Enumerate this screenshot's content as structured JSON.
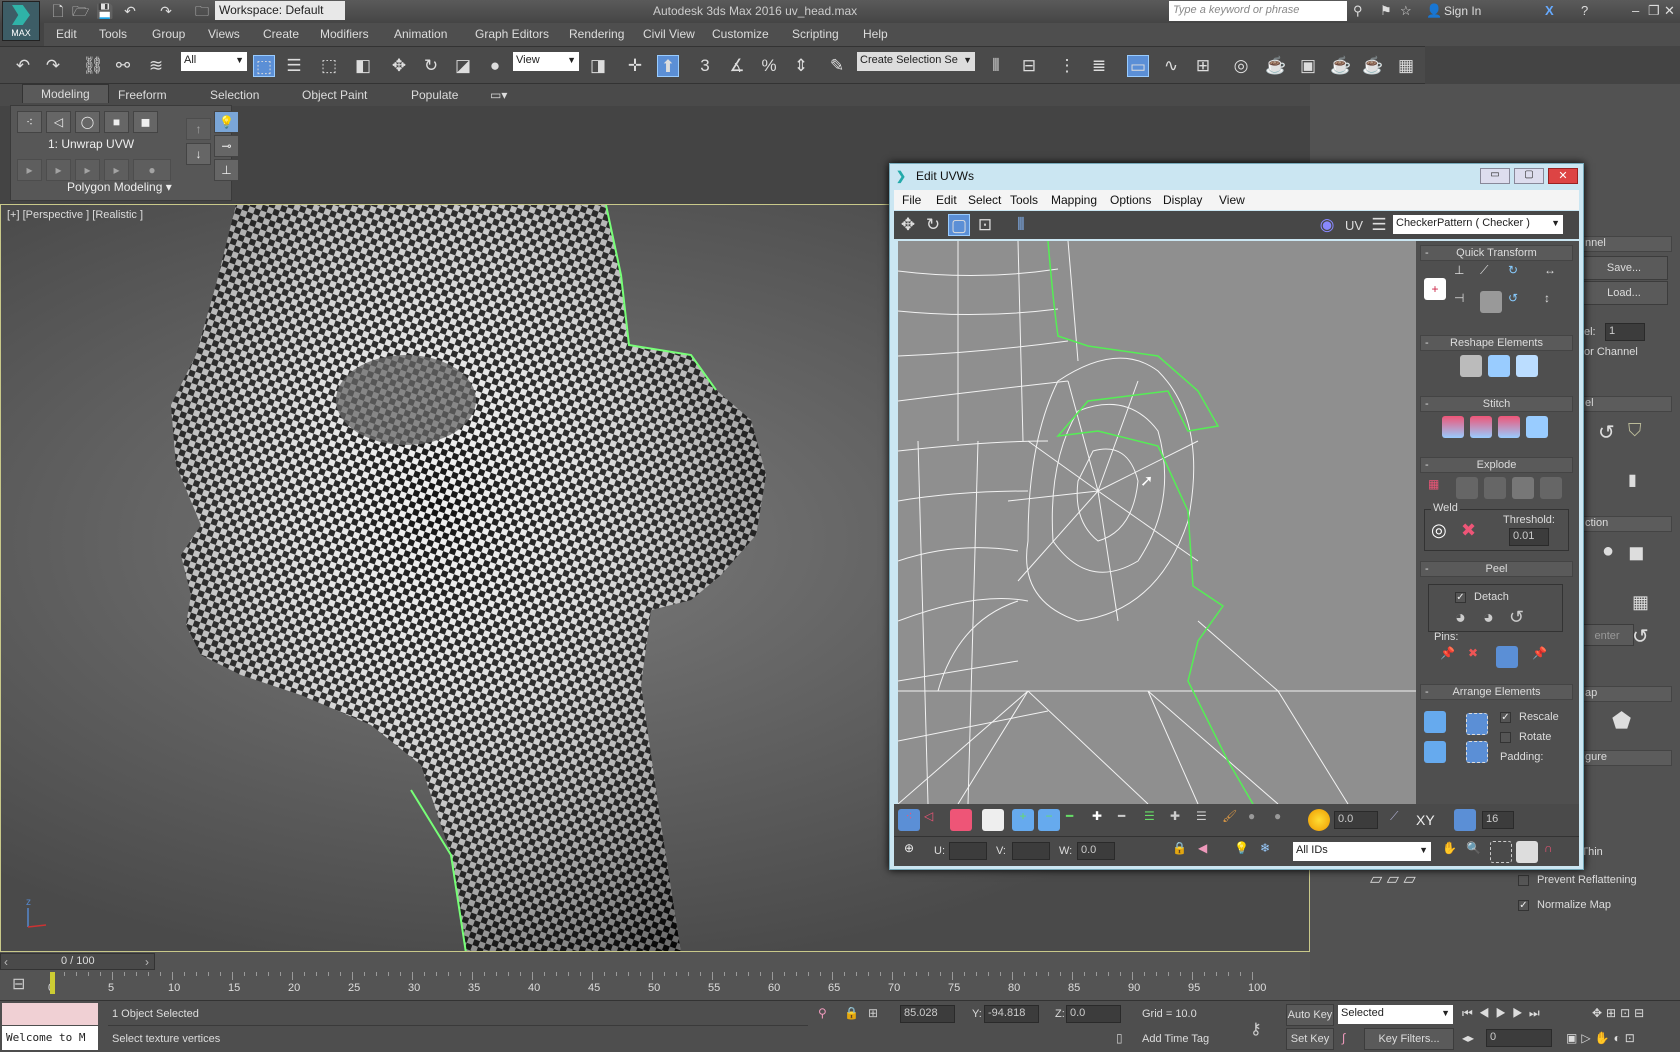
{
  "titlebar": {
    "logo": "MAX",
    "workspace": "Workspace: Default",
    "app_title": "Autodesk 3ds Max 2016    uv_head.max",
    "search_placeholder": "Type a keyword or phrase",
    "sign_in": "Sign In"
  },
  "menu": [
    "Edit",
    "Tools",
    "Group",
    "Views",
    "Create",
    "Modifiers",
    "Animation",
    "Graph Editors",
    "Rendering",
    "Civil View",
    "Customize",
    "Scripting",
    "Help"
  ],
  "toolbar": {
    "filter": "All",
    "ref_coord": "View",
    "selection_set": "Create Selection Se",
    "snap_label": "3"
  },
  "ribbon": {
    "tabs": [
      "Modeling",
      "Freeform",
      "Selection",
      "Object Paint",
      "Populate"
    ],
    "modifier": "1: Unwrap UVW",
    "panel": "Polygon Modeling"
  },
  "viewport": {
    "label": "[+] [Perspective ] [Realistic ]"
  },
  "uvw": {
    "title": "Edit UVWs",
    "menu": [
      "File",
      "Edit",
      "Select",
      "Tools",
      "Mapping",
      "Options",
      "Display",
      "View"
    ],
    "uv_label": "UV",
    "texture": "CheckerPattern  ( Checker )",
    "sections": {
      "quick_transform": "Quick Transform",
      "reshape": "Reshape Elements",
      "stitch": "Stitch",
      "explode": "Explode",
      "weld": "Weld",
      "threshold_label": "Threshold:",
      "threshold": "0.01",
      "peel": "Peel",
      "detach": "Detach",
      "pins": "Pins:",
      "arrange": "Arrange Elements",
      "rescale": "Rescale",
      "rotate": "Rotate",
      "padding": "Padding:"
    },
    "bottom": {
      "soft_value": "0.0",
      "xy": "XY",
      "grid_value": "16",
      "u_label": "U:",
      "v_label": "V:",
      "w_label": "W:",
      "w_value": "0.0",
      "ids": "All IDs"
    }
  },
  "command_panel": {
    "channel_head": "nnel",
    "save": "Save...",
    "load": "Load...",
    "channel_label": "el:",
    "channel_value": "1",
    "map_channel": "or Channel",
    "peel_head": "el",
    "projection_head": "ction",
    "center": "enter",
    "map_head": "ap",
    "configure_head": "gure",
    "thin": "Thin",
    "prevent_reflattening": "Prevent Reflattening",
    "normalize_map": "Normalize Map",
    "checks": {
      "prevent_reflattening": false,
      "normalize_map": true
    }
  },
  "timeline": {
    "frame": "0 / 100",
    "ticks": [
      "0",
      "5",
      "10",
      "15",
      "20",
      "25",
      "30",
      "35",
      "40",
      "45",
      "50",
      "55",
      "60",
      "65",
      "70",
      "75",
      "80",
      "85",
      "90",
      "95",
      "100"
    ]
  },
  "status": {
    "maxscript": "Welcome to M",
    "selection": "1 Object Selected",
    "prompt": "Select texture vertices",
    "x_value": "85.028",
    "y_label": "Y:",
    "y_value": "-94.818",
    "z_label": "Z:",
    "z_value": "0.0",
    "grid": "Grid = 10.0",
    "add_time_tag": "Add Time Tag",
    "auto_key": "Auto Key",
    "key_mode": "Selected",
    "set_key": "Set Key",
    "key_filters": "Key Filters...",
    "current_frame": "0"
  }
}
